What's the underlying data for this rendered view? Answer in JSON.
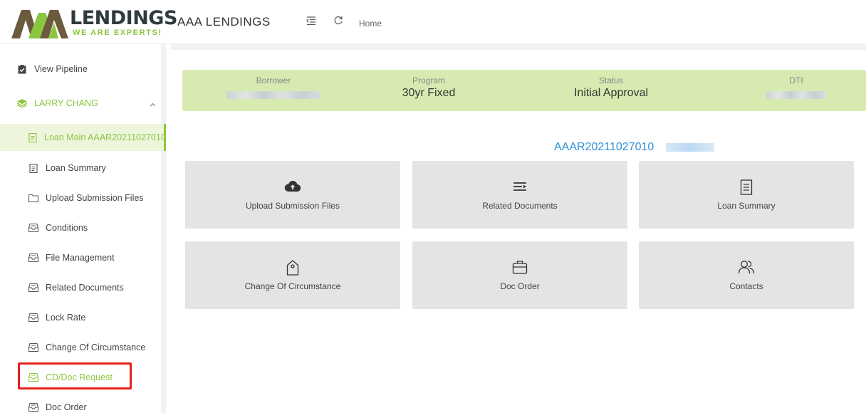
{
  "header": {
    "logo_word": "LENDINGS",
    "logo_tag": "WE ARE EXPERTS!",
    "app_title": "AAA LENDINGS",
    "menu_toggle_icon": "indent-icon",
    "refresh_icon": "refresh-icon",
    "home_label": "Home"
  },
  "sidebar": {
    "view_pipeline": "View Pipeline",
    "borrower_group": "LARRY CHANG",
    "items": [
      {
        "label": "Loan Main AAAR20211027010",
        "icon": "document-icon"
      },
      {
        "label": "Loan Summary",
        "icon": "document-icon"
      },
      {
        "label": "Upload Submission Files",
        "icon": "folder-icon"
      },
      {
        "label": "Conditions",
        "icon": "tray-icon"
      },
      {
        "label": "File Management",
        "icon": "tray-icon"
      },
      {
        "label": "Related Documents",
        "icon": "tray-icon"
      },
      {
        "label": "Lock Rate",
        "icon": "tray-icon"
      },
      {
        "label": "Change Of Circumstance",
        "icon": "tray-icon"
      },
      {
        "label": "CD/Doc Request",
        "icon": "tray-icon"
      },
      {
        "label": "Doc Order",
        "icon": "tray-icon"
      }
    ]
  },
  "summary": {
    "borrower_label": "Borrower",
    "program_label": "Program",
    "program_value": "30yr Fixed",
    "status_label": "Status",
    "status_value": "Initial Approval",
    "dti_label": "DTI"
  },
  "loan_number": "AAAR20211027010",
  "tiles": [
    {
      "label": "Upload Submission Files",
      "icon": "cloud-upload-icon"
    },
    {
      "label": "Related Documents",
      "icon": "list-icon"
    },
    {
      "label": "Loan Summary",
      "icon": "document-icon"
    },
    {
      "label": "Change Of Circumstance",
      "icon": "tag-icon"
    },
    {
      "label": "Doc Order",
      "icon": "briefcase-icon"
    },
    {
      "label": "Contacts",
      "icon": "contacts-icon"
    }
  ],
  "colors": {
    "accent": "#8cc63f",
    "summary_bg": "#d7ebb1",
    "link": "#2d8fd8",
    "highlight": "#e6201a",
    "tile_bg": "#e4e4e4"
  }
}
